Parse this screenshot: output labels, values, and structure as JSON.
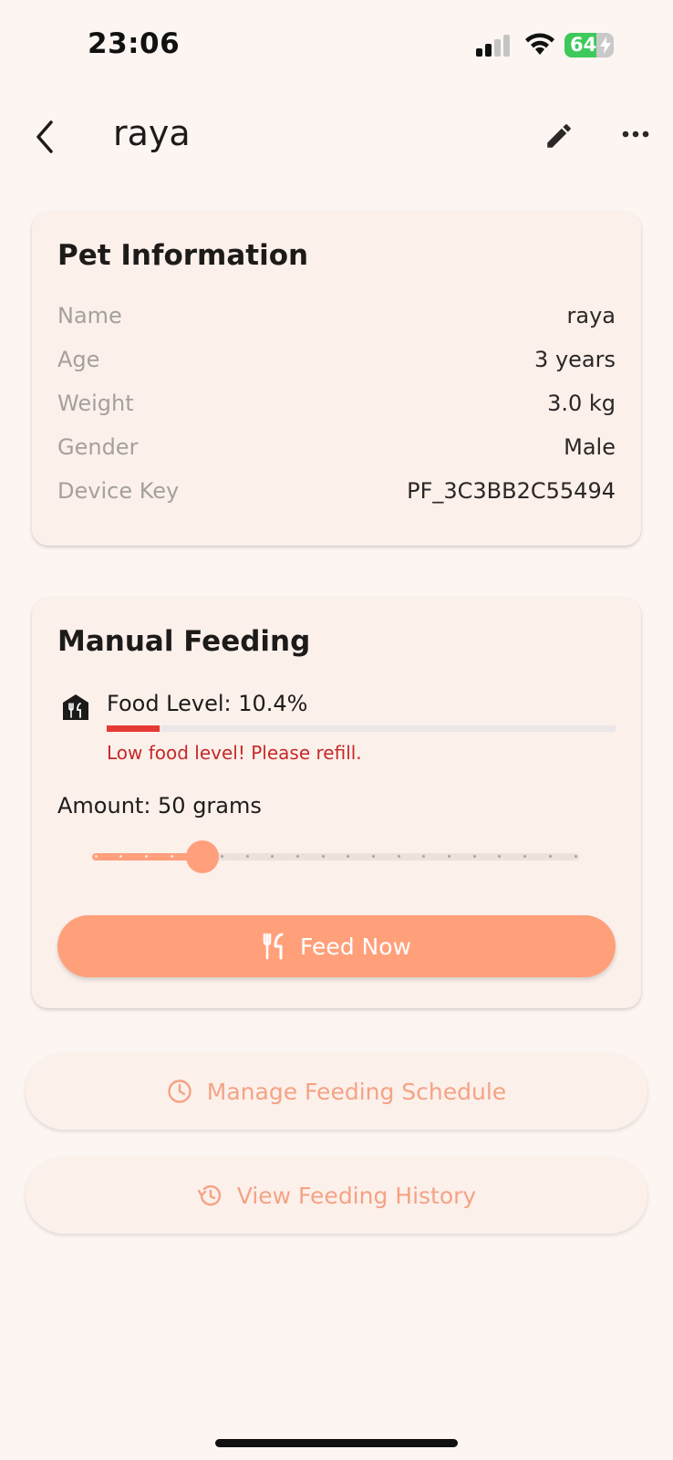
{
  "status_bar": {
    "time": "23:06",
    "battery": "64",
    "battery_level": 0.64
  },
  "app_bar": {
    "title": "raya"
  },
  "pet_info": {
    "title": "Pet Information",
    "rows": [
      {
        "label": "Name",
        "value": "raya"
      },
      {
        "label": "Age",
        "value": "3 years"
      },
      {
        "label": "Weight",
        "value": "3.0 kg"
      },
      {
        "label": "Gender",
        "value": "Male"
      },
      {
        "label": "Device Key",
        "value": "PF_3C3BB2C55494"
      }
    ]
  },
  "manual_feeding": {
    "title": "Manual Feeding",
    "food_level_text": "Food Level: 10.4%",
    "food_level": 10.4,
    "warning": "Low food level! Please refill.",
    "amount_text": "Amount: 50 grams",
    "slider_value": 0.2,
    "feed_button": "Feed Now"
  },
  "actions": {
    "schedule": "Manage Feeding Schedule",
    "history": "View Feeding History"
  },
  "colors": {
    "accent": "#ffa07a",
    "warning": "#e53935",
    "background": "#fdf5f2",
    "card": "#fcf0eb"
  },
  "icons": [
    "back-icon",
    "edit-icon",
    "more-icon",
    "food-icon",
    "fork-knife-icon",
    "clock-icon",
    "history-icon"
  ]
}
